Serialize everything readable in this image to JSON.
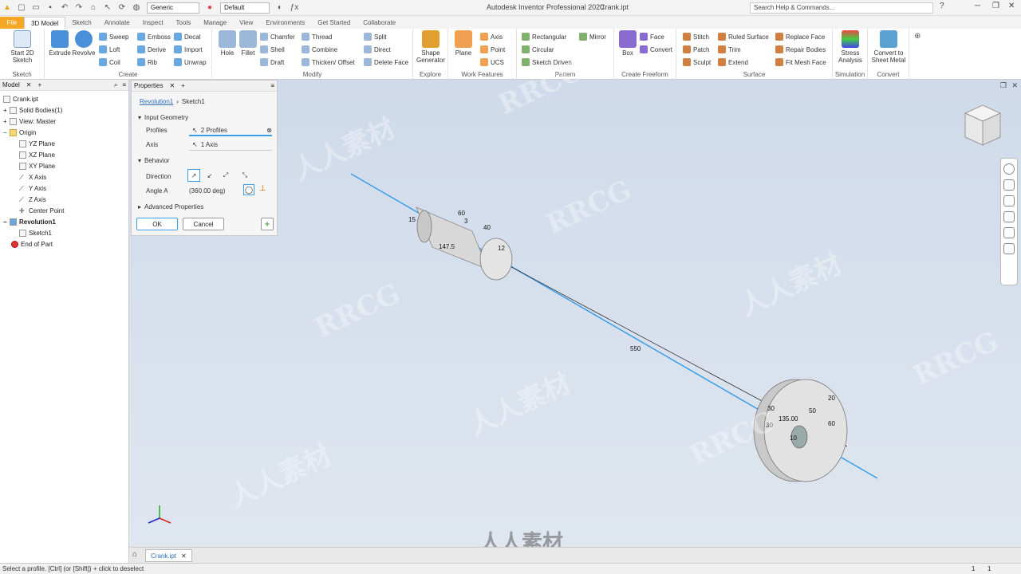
{
  "titlebar": {
    "app_title": "Autodesk Inventor Professional 2020",
    "file_name": "Crank.ipt",
    "material": "Generic",
    "appearance": "Default",
    "search_placeholder": "Search Help & Commands..."
  },
  "tabs": {
    "file": "File",
    "items": [
      "3D Model",
      "Sketch",
      "Annotate",
      "Inspect",
      "Tools",
      "Manage",
      "View",
      "Environments",
      "Get Started",
      "Collaborate"
    ]
  },
  "ribbon": {
    "sketch": {
      "label": "Sketch",
      "start": "Start 2D Sketch"
    },
    "create": {
      "label": "Create",
      "extrude": "Extrude",
      "revolve": "Revolve",
      "sweep": "Sweep",
      "emboss": "Emboss",
      "decal": "Decal",
      "loft": "Loft",
      "derive": "Derive",
      "import": "Import",
      "coil": "Coil",
      "rib": "Rib",
      "unwrap": "Unwrap"
    },
    "modify": {
      "label": "Modify",
      "hole": "Hole",
      "fillet": "Fillet",
      "chamfer": "Chamfer",
      "thread": "Thread",
      "split": "Split",
      "shell": "Shell",
      "combine": "Combine",
      "direct": "Direct",
      "draft": "Draft",
      "thicken": "Thicken/ Offset",
      "delete_face": "Delete Face"
    },
    "explore": {
      "label": "Explore",
      "shape_generator": "Shape Generator"
    },
    "work_features": {
      "label": "Work Features",
      "plane": "Plane",
      "axis": "Axis",
      "point": "Point",
      "ucs": "UCS"
    },
    "pattern": {
      "label": "Pattern",
      "rectangular": "Rectangular",
      "circular": "Circular",
      "sketch_driven": "Sketch Driven",
      "mirror": "Mirror"
    },
    "freeform": {
      "label": "Create Freeform",
      "box": "Box",
      "face": "Face",
      "convert": "Convert"
    },
    "surface": {
      "label": "Surface",
      "stitch": "Stitch",
      "patch": "Patch",
      "sculpt": "Sculpt",
      "ruled_surface": "Ruled Surface",
      "trim": "Trim",
      "extend": "Extend",
      "replace_face": "Replace Face",
      "repair_bodies": "Repair Bodies",
      "fit_mesh_face": "Fit Mesh Face"
    },
    "simulation": {
      "label": "Simulation",
      "stress": "Stress Analysis"
    },
    "convert": {
      "label": "Convert",
      "sheet_metal": "Convert to Sheet Metal"
    }
  },
  "browser": {
    "tab": "Model",
    "items": [
      {
        "label": "Crank.ipt",
        "indent": 0
      },
      {
        "label": "Solid Bodies(1)",
        "indent": 1
      },
      {
        "label": "View: Master",
        "indent": 1
      },
      {
        "label": "Origin",
        "indent": 1
      },
      {
        "label": "YZ Plane",
        "indent": 2
      },
      {
        "label": "XZ Plane",
        "indent": 2
      },
      {
        "label": "XY Plane",
        "indent": 2
      },
      {
        "label": "X Axis",
        "indent": 2
      },
      {
        "label": "Y Axis",
        "indent": 2
      },
      {
        "label": "Z Axis",
        "indent": 2
      },
      {
        "label": "Center Point",
        "indent": 2
      },
      {
        "label": "Revolution1",
        "indent": 1
      },
      {
        "label": "Sketch1",
        "indent": 2
      },
      {
        "label": "End of Part",
        "indent": 1
      }
    ]
  },
  "properties": {
    "tab": "Properties",
    "breadcrumb_feature": "Revolution1",
    "breadcrumb_sketch": "Sketch1",
    "input_geometry": "Input Geometry",
    "profiles_label": "Profiles",
    "profiles_value": "2 Profiles",
    "axis_label": "Axis",
    "axis_value": "1 Axis",
    "behavior": "Behavior",
    "direction_label": "Direction",
    "angle_label": "Angle A",
    "angle_value": "(360.00 deg)",
    "advanced": "Advanced Properties",
    "ok": "OK",
    "cancel": "Cancel"
  },
  "dimensions": [
    "15",
    "60",
    "3",
    "40",
    "147.5",
    "12",
    "550",
    "20",
    "30",
    "135.00",
    "50",
    "30",
    "60",
    "10"
  ],
  "doc_tab": "Crank.ipt",
  "status": {
    "text": "Select a profile. [Ctrl] (or [Shift]) + click to deselect",
    "page_a": "1",
    "page_b": "1"
  },
  "watermarks": [
    "RRCG",
    "人人素材"
  ],
  "colors": {
    "accent": "#2a6ebb",
    "file_tab": "#f5a623",
    "axis_line": "#3a9ee8"
  }
}
